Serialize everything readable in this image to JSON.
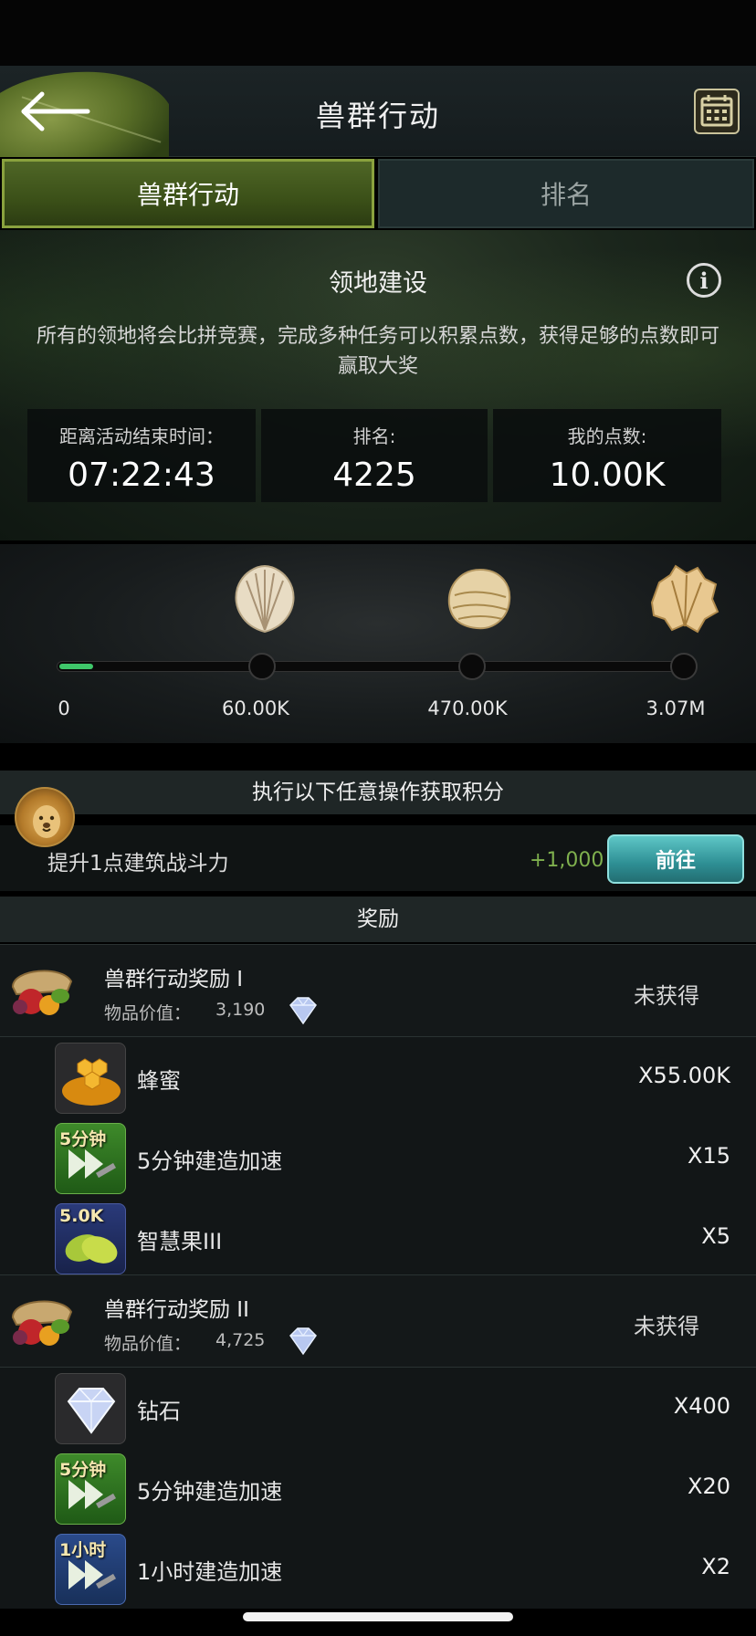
{
  "header": {
    "title": "兽群行动"
  },
  "tabs": [
    {
      "label": "兽群行动",
      "active": true
    },
    {
      "label": "排名",
      "active": false
    }
  ],
  "banner": {
    "title": "领地建设",
    "description": "所有的领地将会比拼竞赛，完成多种任务可以积累点数，获得足够的点数即可赢取大奖"
  },
  "stats": {
    "time_label": "距离活动结束时间：",
    "time_value": "07:22:43",
    "rank_label": "排名:",
    "rank_value": "4225",
    "points_label": "我的点数:",
    "points_value": "10.00K"
  },
  "progress": {
    "current": 10000,
    "max": 3070000,
    "milestones": [
      "0",
      "60.00K",
      "470.00K",
      "3.07M"
    ]
  },
  "ops": {
    "header": "执行以下任意操作获取积分",
    "task_label": "提升1点建筑战斗力",
    "task_points": "+1,000",
    "go_label": "前往"
  },
  "rewards": {
    "header": "奖励",
    "tiers": [
      {
        "title": "兽群行动奖励 I",
        "value_label": "物品价值：",
        "value": "3,190",
        "status": "未获得",
        "items": [
          {
            "name": "蜂蜜",
            "qty": "X55.00K",
            "icon": "honeycomb-icon",
            "tag": ""
          },
          {
            "name": "5分钟建造加速",
            "qty": "X15",
            "icon": "speedup-icon",
            "tag": "5分钟"
          },
          {
            "name": "智慧果III",
            "qty": "X5",
            "icon": "wisdom-fruit-icon",
            "tag": "5.0K"
          }
        ]
      },
      {
        "title": "兽群行动奖励 II",
        "value_label": "物品价值：",
        "value": "4,725",
        "status": "未获得",
        "items": [
          {
            "name": "钻石",
            "qty": "X400",
            "icon": "diamond-icon",
            "tag": ""
          },
          {
            "name": "5分钟建造加速",
            "qty": "X20",
            "icon": "speedup-icon",
            "tag": "5分钟"
          },
          {
            "name": "1小时建造加速",
            "qty": "X2",
            "icon": "speedup-icon",
            "tag": "1小时"
          }
        ]
      }
    ]
  },
  "colors": {
    "accent_green": "#8aa23e",
    "progress_green": "#3fc76a",
    "points_green": "#7fb04e",
    "go_button": "#2e8f94"
  }
}
